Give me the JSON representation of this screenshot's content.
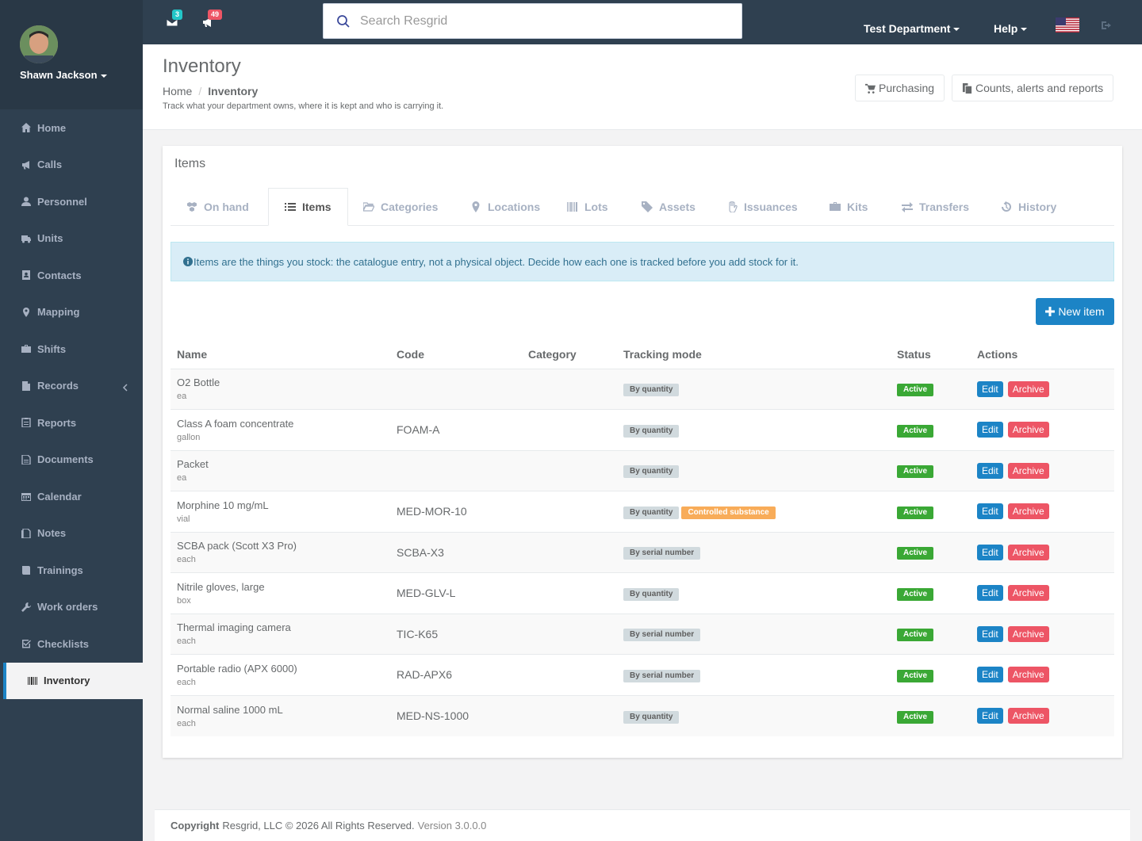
{
  "user": {
    "name": "Shawn Jackson"
  },
  "sidebar": {
    "items": [
      {
        "label": "Home",
        "icon": "home-icon"
      },
      {
        "label": "Calls",
        "icon": "bullhorn-icon"
      },
      {
        "label": "Personnel",
        "icon": "user-icon"
      },
      {
        "label": "Units",
        "icon": "truck-icon"
      },
      {
        "label": "Contacts",
        "icon": "address-book-icon"
      },
      {
        "label": "Mapping",
        "icon": "map-marker-icon"
      },
      {
        "label": "Shifts",
        "icon": "briefcase-icon"
      },
      {
        "label": "Records",
        "icon": "file-icon"
      },
      {
        "label": "Reports",
        "icon": "clipboard-icon"
      },
      {
        "label": "Documents",
        "icon": "document-icon"
      },
      {
        "label": "Calendar",
        "icon": "calendar-icon"
      },
      {
        "label": "Notes",
        "icon": "notes-icon"
      },
      {
        "label": "Trainings",
        "icon": "book-icon"
      },
      {
        "label": "Work orders",
        "icon": "wrench-icon"
      },
      {
        "label": "Checklists",
        "icon": "checkbox-icon"
      },
      {
        "label": "Inventory",
        "icon": "barcode-icon",
        "active": true
      }
    ]
  },
  "topbar": {
    "messages_count": "3",
    "notifications_count": "49",
    "search_placeholder": "Search Resgrid",
    "department": "Test Department",
    "help": "Help"
  },
  "header": {
    "title": "Inventory",
    "breadcrumb_home": "Home",
    "breadcrumb_current": "Inventory",
    "subtitle": "Track what your department owns, where it is kept and who is carrying it.",
    "purchasing_label": "Purchasing",
    "counts_label": "Counts, alerts and reports"
  },
  "panel": {
    "title": "Items",
    "tabs": [
      "On hand",
      "Items",
      "Categories",
      "Locations",
      "Lots",
      "Assets",
      "Issuances",
      "Kits",
      "Transfers",
      "History"
    ],
    "alert": "Items are the things you stock: the catalogue entry, not a physical object. Decide how each one is tracked before you add stock for it.",
    "new_item_label": "New item"
  },
  "table": {
    "headers": [
      "Name",
      "Code",
      "Category",
      "Tracking mode",
      "Status",
      "Actions"
    ],
    "rows": [
      {
        "name": "O2 Bottle",
        "unit": "ea",
        "code": "",
        "category": "",
        "tracking": "By quantity",
        "extra": "",
        "status": "Active"
      },
      {
        "name": "Class A foam concentrate",
        "unit": "gallon",
        "code": "FOAM-A",
        "category": "",
        "tracking": "By quantity",
        "extra": "",
        "status": "Active"
      },
      {
        "name": "Packet",
        "unit": "ea",
        "code": "",
        "category": "",
        "tracking": "By quantity",
        "extra": "",
        "status": "Active"
      },
      {
        "name": "Morphine 10 mg/mL",
        "unit": "vial",
        "code": "MED-MOR-10",
        "category": "",
        "tracking": "By quantity",
        "extra": "Controlled substance",
        "status": "Active"
      },
      {
        "name": "SCBA pack (Scott X3 Pro)",
        "unit": "each",
        "code": "SCBA-X3",
        "category": "",
        "tracking": "By serial number",
        "extra": "",
        "status": "Active"
      },
      {
        "name": "Nitrile gloves, large",
        "unit": "box",
        "code": "MED-GLV-L",
        "category": "",
        "tracking": "By quantity",
        "extra": "",
        "status": "Active"
      },
      {
        "name": "Thermal imaging camera",
        "unit": "each",
        "code": "TIC-K65",
        "category": "",
        "tracking": "By serial number",
        "extra": "",
        "status": "Active"
      },
      {
        "name": "Portable radio (APX 6000)",
        "unit": "each",
        "code": "RAD-APX6",
        "category": "",
        "tracking": "By serial number",
        "extra": "",
        "status": "Active"
      },
      {
        "name": "Normal saline 1000 mL",
        "unit": "each",
        "code": "MED-NS-1000",
        "category": "",
        "tracking": "By quantity",
        "extra": "",
        "status": "Active"
      }
    ],
    "edit_label": "Edit",
    "archive_label": "Archive"
  },
  "footer": {
    "copyright": "Copyright",
    "company": "Resgrid, LLC © 2026 All Rights Reserved.",
    "version": "Version 3.0.0.0"
  },
  "colors": {
    "sidebar": "#2f4050",
    "primary": "#1c84c6",
    "danger": "#ed5565",
    "success": "#3aa835",
    "warning": "#f8ac59"
  }
}
